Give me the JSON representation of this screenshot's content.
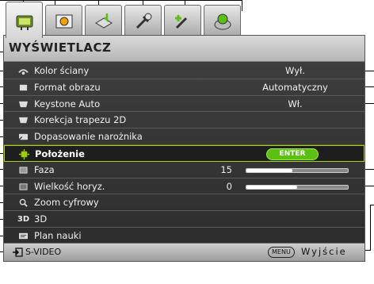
{
  "tabs": [
    {
      "icon": "display-tab-icon",
      "active": true
    },
    {
      "icon": "picture-tab-icon",
      "active": false
    },
    {
      "icon": "source-tab-icon",
      "active": false
    },
    {
      "icon": "system-setup-tab-icon",
      "active": false
    },
    {
      "icon": "advanced-setup-tab-icon",
      "active": false
    },
    {
      "icon": "information-tab-icon",
      "active": false
    }
  ],
  "panel": {
    "title": "WYŚWIETLACZ"
  },
  "menu": {
    "items": [
      {
        "label": "Kolor ściany",
        "value": "Wył.",
        "icon": "wall-color-icon"
      },
      {
        "label": "Format obrazu",
        "value": "Automatyczny",
        "icon": "aspect-ratio-icon"
      },
      {
        "label": "Keystone Auto",
        "value": "Wł.",
        "icon": "auto-keystone-icon"
      },
      {
        "label": "Korekcja trapezu 2D",
        "value": "",
        "icon": "keystone-2d-icon"
      },
      {
        "label": "Dopasowanie narożnika",
        "value": "",
        "icon": "corner-fit-icon"
      },
      {
        "label": "Położenie",
        "value": "ENTER",
        "icon": "position-icon"
      },
      {
        "label": "Faza",
        "value": "15",
        "slider": 0.45,
        "icon": "phase-icon"
      },
      {
        "label": "Wielkość horyz.",
        "value": "0",
        "slider": 0.5,
        "icon": "h-size-icon"
      },
      {
        "label": "Zoom cyfrowy",
        "value": "",
        "icon": "digital-zoom-icon"
      },
      {
        "label": "3D",
        "value": "",
        "icon": "3d-icon",
        "icon_text": "3D"
      },
      {
        "label": "Plan nauki",
        "value": "",
        "icon": "teaching-template-icon"
      }
    ]
  },
  "footer": {
    "source": "S-VIDEO",
    "menu_key": "MENU",
    "exit": "Wyjście"
  },
  "colors": {
    "accent": "#a8d400",
    "enter": "#5bbf14",
    "panel": "#2c2c2c"
  }
}
